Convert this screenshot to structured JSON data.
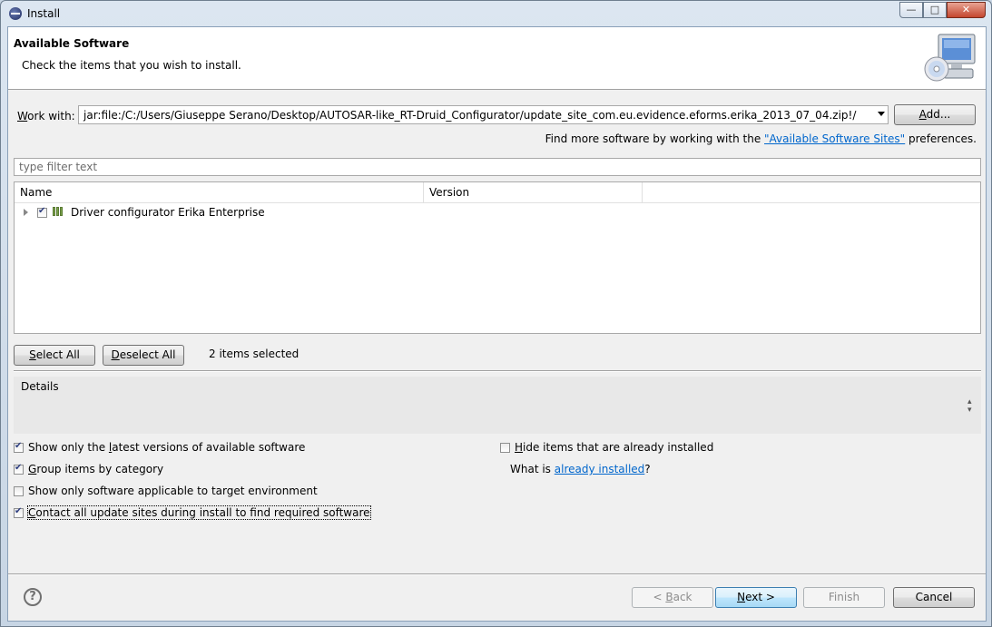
{
  "window": {
    "title": "Install"
  },
  "banner": {
    "title": "Available Software",
    "subtitle": "Check the items that you wish to install."
  },
  "work_with": {
    "label": "Work with:",
    "value": "jar:file:/C:/Users/Giuseppe Serano/Desktop/AUTOSAR-like_RT-Druid_Configurator/update_site_com.eu.evidence.eforms.erika_2013_07_04.zip!/",
    "add_button": "Add..."
  },
  "find_more": {
    "prefix": "Find more software by working with the ",
    "link": "\"Available Software Sites\"",
    "suffix": " preferences."
  },
  "filter": {
    "placeholder": "type filter text"
  },
  "tree": {
    "columns": [
      "Name",
      "Version",
      ""
    ],
    "rows": [
      {
        "label": "Driver configurator Erika Enterprise",
        "version": "",
        "checked": true,
        "expandable": true
      }
    ]
  },
  "selection": {
    "select_all": "Select All",
    "deselect_all": "Deselect All",
    "count_text": "2 items selected"
  },
  "details": {
    "label": "Details"
  },
  "options": {
    "latest_versions": {
      "label": "Show only the latest versions of available software",
      "checked": true
    },
    "group_by_category": {
      "label": "Group items by category",
      "checked": true
    },
    "applicable_only": {
      "label": "Show only software applicable to target environment",
      "checked": false
    },
    "contact_all_sites": {
      "label": "Contact all update sites during install to find required software",
      "checked": true
    },
    "hide_installed": {
      "label": "Hide items that are already installed",
      "checked": false
    },
    "what_is": {
      "prefix": "What is ",
      "link": "already installed",
      "suffix": "?"
    }
  },
  "footer": {
    "back": "< Back",
    "next": "Next >",
    "finish": "Finish",
    "cancel": "Cancel"
  },
  "icons": {
    "app": "eclipse-icon",
    "banner": "computer-cd-icon",
    "help": "question-mark-icon",
    "feature": "feature-icon"
  }
}
